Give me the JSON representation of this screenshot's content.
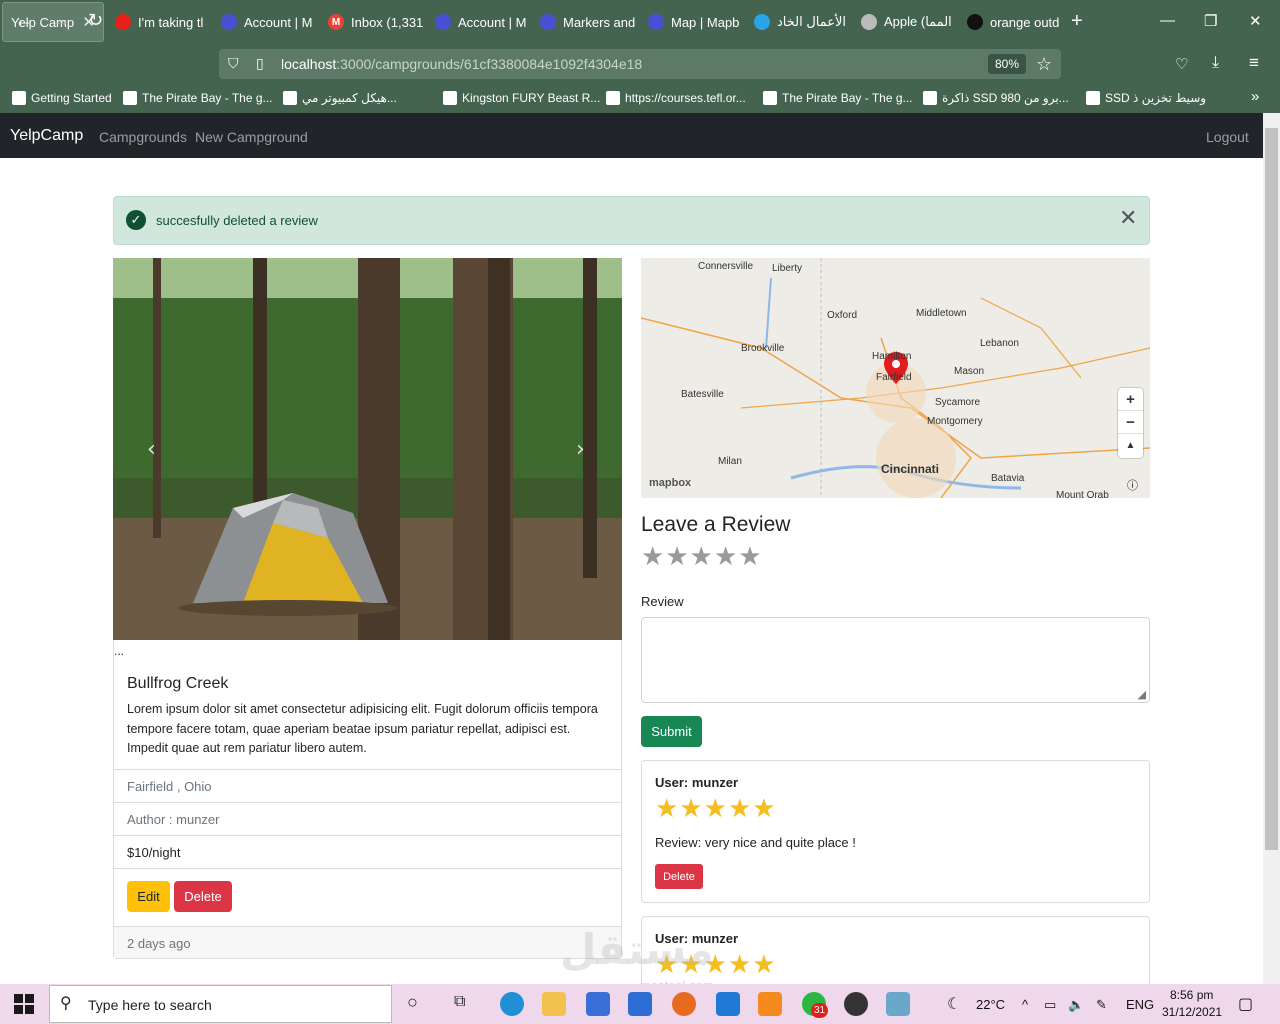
{
  "browser": {
    "tabs": [
      {
        "label": "Yelp Camp",
        "color": "#44644f",
        "active": true
      },
      {
        "label": "I'm taking tl",
        "color": "#e62117"
      },
      {
        "label": "Account | M",
        "color": "#4a4fd6"
      },
      {
        "label": "Inbox (1,331",
        "color": "#ea4335",
        "icon": "M"
      },
      {
        "label": "Account | M",
        "color": "#4a4fd6"
      },
      {
        "label": "Markers and",
        "color": "#4a4fd6"
      },
      {
        "label": "Map | Mapb",
        "color": "#4a4fd6"
      },
      {
        "label": "الأعمال الخاد",
        "color": "#2aa3e8"
      },
      {
        "label": "Apple (المما",
        "color": "#bbbbbb"
      },
      {
        "label": "orange outd",
        "color": "#111111"
      }
    ],
    "url_host": "localhost",
    "url_path": ":3000/campgrounds/61cf3380084e1092f4304e18",
    "zoom": "80%",
    "bookmarks": [
      "Getting Started",
      "The Pirate Bay - The g...",
      "هيكل كمبيوتر مي...",
      "Kingston FURY Beast R...",
      "https://courses.tefl.or...",
      "The Pirate Bay - The g...",
      "ذاكرة SSD 980 برو من...",
      "SSD وسيط تخزين ذ"
    ]
  },
  "app_nav": {
    "brand": "YelpCamp",
    "links": [
      "Campgrounds",
      "New Campground"
    ],
    "logout": "Logout"
  },
  "alert": {
    "message": "succesfully deleted a review",
    "color": "#0f5132"
  },
  "campground": {
    "image_caption": "...",
    "title": "Bullfrog Creek",
    "description": "Lorem ipsum dolor sit amet consectetur adipisicing elit. Fugit dolorum officiis tempora tempore facere totam, quae aperiam beatae ipsum pariatur repellat, adipisci est. Impedit quae aut rem pariatur libero autem.",
    "location": "Fairfield , Ohio",
    "author": "Author : munzer",
    "price": "$10/night",
    "edit_label": "Edit",
    "delete_label": "Delete",
    "footer": "2 days ago"
  },
  "map": {
    "labels": [
      "Connersville",
      "Liberty",
      "Oxford",
      "Middletown",
      "Brookville",
      "Hamilton",
      "Fairfield",
      "Lebanon",
      "Mason",
      "Batesville",
      "Sycamore",
      "Montgomery",
      "Milan",
      "Cincinnati",
      "Batavia",
      "Mount Orab"
    ],
    "zoom_in": "+",
    "zoom_out": "−",
    "compass": "▲",
    "attribution": "mapbox"
  },
  "review_form": {
    "heading": "Leave a Review",
    "rating_value": 0,
    "rating_max": 5,
    "label": "Review",
    "textarea_value": "",
    "submit_label": "Submit"
  },
  "reviews": [
    {
      "user": "User: munzer",
      "rating": 5,
      "text": "Review: very nice and quite place !",
      "delete_label": "Delete"
    },
    {
      "user": "User: munzer",
      "rating": 5
    }
  ],
  "watermark": {
    "text": "مستقل",
    "sub": "mostaql.com"
  },
  "taskbar": {
    "search_placeholder": "Type here to search",
    "badge": "31",
    "weather": "22°C",
    "language": "ENG",
    "time": "8:56 pm",
    "date": "31/12/2021"
  }
}
